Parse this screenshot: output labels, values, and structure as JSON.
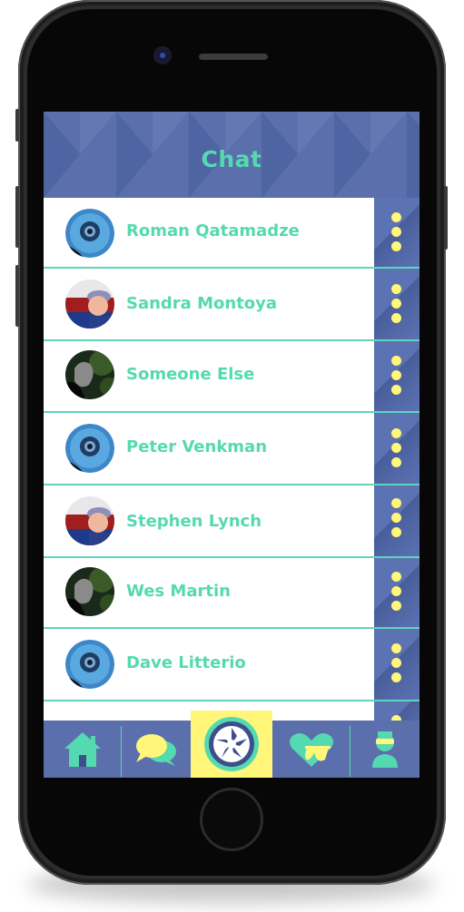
{
  "app": {
    "title": "Chat"
  },
  "chats": [
    {
      "name": "Roman Qatamadze",
      "avatar": "blue-camera-lens-photo"
    },
    {
      "name": "Sandra Montoya",
      "avatar": "person-in-cap-photo"
    },
    {
      "name": "Someone Else",
      "avatar": "dark-hand-photo"
    },
    {
      "name": "Peter Venkman",
      "avatar": "blue-camera-lens-photo"
    },
    {
      "name": "Stephen Lynch",
      "avatar": "person-in-cap-photo"
    },
    {
      "name": "Wes Martin",
      "avatar": "dark-hand-photo"
    },
    {
      "name": "Dave Litterio",
      "avatar": "blue-camera-lens-photo"
    }
  ],
  "tabbar": {
    "tabs": [
      {
        "icon": "home-icon"
      },
      {
        "icon": "chat-bubbles-icon"
      },
      {
        "icon": "camera-shutter-icon",
        "active": true
      },
      {
        "icon": "heart-sunglasses-icon"
      },
      {
        "icon": "person-sunglasses-icon"
      }
    ]
  },
  "colors": {
    "header_bg": "#5a6fac",
    "accent_teal": "#55d9b0",
    "accent_yellow": "#fff67a",
    "menu_strip": "#5b72b3"
  }
}
